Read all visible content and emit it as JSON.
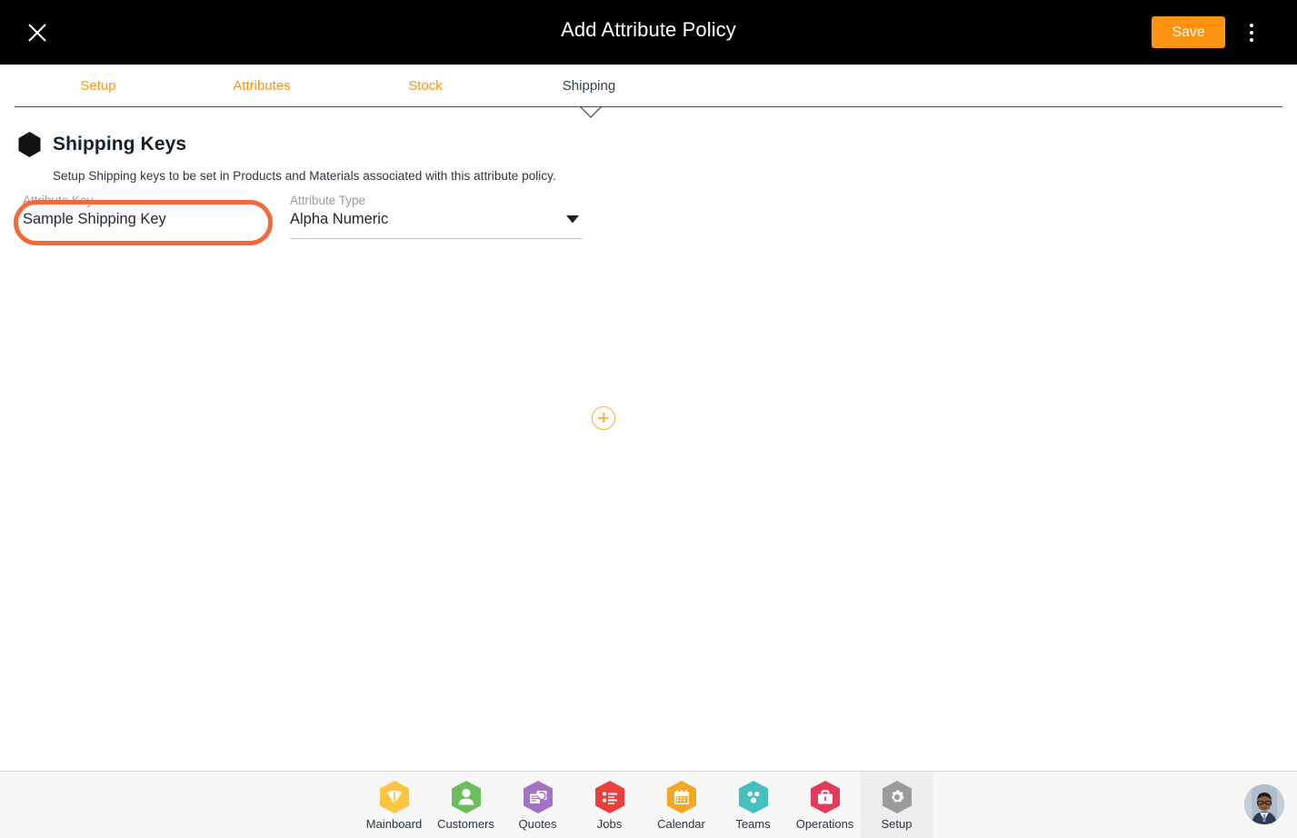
{
  "window": {
    "title": "Add Attribute Policy",
    "close_icon": "close-icon",
    "save_label": "Save",
    "menu_icon": "kebab-menu-icon",
    "accent_orange": "#FF9211",
    "title_bar_bg": "#000000"
  },
  "tabs": {
    "items": [
      {
        "label": "Setup",
        "active": false
      },
      {
        "label": "Attributes",
        "active": false
      },
      {
        "label": "Stock",
        "active": false
      },
      {
        "label": "Shipping",
        "active": true
      }
    ],
    "inactive_color": "#FF9211",
    "active_color": "#32404e"
  },
  "section": {
    "icon": "hexagon-icon",
    "title": "Shipping Keys",
    "description": "Setup Shipping keys to be set in Products and Materials associated with this attribute policy."
  },
  "form": {
    "attribute_key": {
      "label": "Attribute Key",
      "value": "Sample Shipping Key",
      "placeholder": "Attribute Key",
      "highlighted": true,
      "highlight_color": "#F4683A"
    },
    "attribute_type": {
      "label": "Attribute Type",
      "value": "Alpha Numeric",
      "caret_icon": "chevron-down-icon",
      "options": [
        "Alpha Numeric"
      ]
    },
    "add_button": {
      "icon": "plus-circle-icon",
      "color": "#FBB040"
    }
  },
  "bottom_nav": {
    "items": [
      {
        "label": "Mainboard",
        "icon": "mainboard-icon",
        "color": "#FDC53F",
        "active": false
      },
      {
        "label": "Customers",
        "icon": "customers-icon",
        "color": "#6CBE5A",
        "active": false
      },
      {
        "label": "Quotes",
        "icon": "quotes-icon",
        "color": "#A173C4",
        "active": false
      },
      {
        "label": "Jobs",
        "icon": "jobs-icon",
        "color": "#E8413C",
        "active": false
      },
      {
        "label": "Calendar",
        "icon": "calendar-icon",
        "color": "#F5A623",
        "active": false
      },
      {
        "label": "Teams",
        "icon": "teams-icon",
        "color": "#45BFBF",
        "active": false
      },
      {
        "label": "Operations",
        "icon": "operations-icon",
        "color": "#E23B5B",
        "active": false
      },
      {
        "label": "Setup",
        "icon": "setup-gear-icon",
        "color": "#9B9B9B",
        "active": true
      }
    ],
    "active_bg": "#eeeeee"
  },
  "user": {
    "avatar": "user-avatar"
  }
}
